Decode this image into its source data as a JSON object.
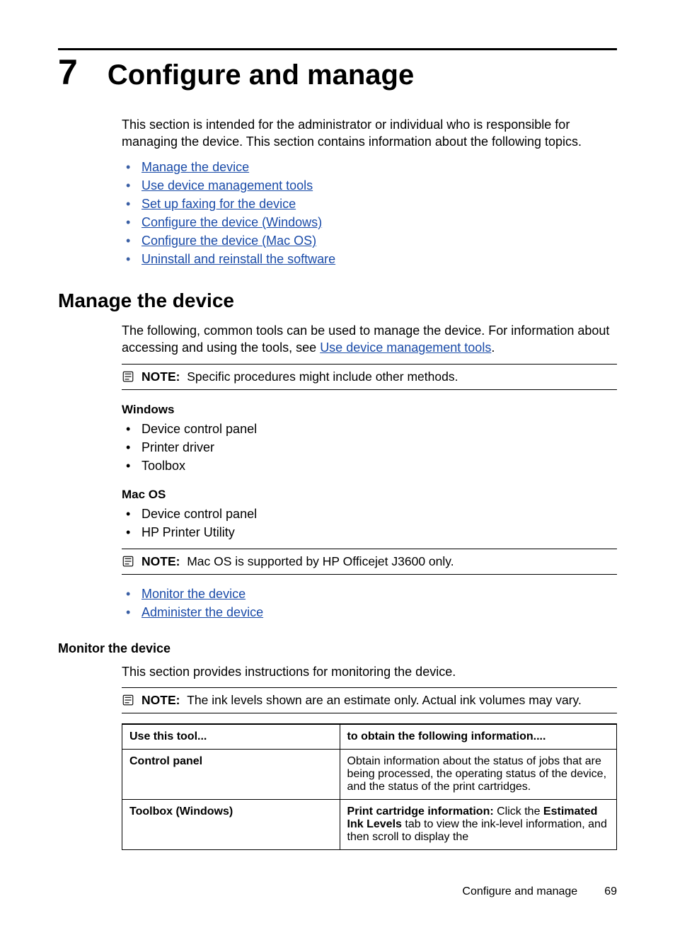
{
  "chapter": {
    "number": "7",
    "title": "Configure and manage"
  },
  "intro": "This section is intended for the administrator or individual who is responsible for managing the device. This section contains information about the following topics.",
  "toc": [
    "Manage the device",
    "Use device management tools",
    "Set up faxing for the device",
    "Configure the device (Windows)",
    "Configure the device (Mac OS)",
    "Uninstall and reinstall the software"
  ],
  "manage": {
    "heading": "Manage the device",
    "para_pre": "The following, common tools can be used to manage the device. For information about accessing and using the tools, see ",
    "para_link": "Use device management tools",
    "para_post": ".",
    "note1": {
      "label": "NOTE:",
      "text": "Specific procedures might include other methods."
    },
    "windows": {
      "heading": "Windows",
      "items": [
        "Device control panel",
        "Printer driver",
        "Toolbox"
      ]
    },
    "macos": {
      "heading": "Mac OS",
      "items": [
        "Device control panel",
        "HP Printer Utility"
      ]
    },
    "note2": {
      "label": "NOTE:",
      "text": "Mac OS is supported by HP Officejet J3600 only."
    },
    "sublinks": [
      "Monitor the device",
      "Administer the device"
    ]
  },
  "monitor": {
    "heading": "Monitor the device",
    "para": "This section provides instructions for monitoring the device.",
    "note": {
      "label": "NOTE:",
      "text": "The ink levels shown are an estimate only. Actual ink volumes may vary."
    },
    "table": {
      "col1": "Use this tool...",
      "col2": "to obtain the following information....",
      "rows": [
        {
          "tool": "Control panel",
          "info_plain": "Obtain information about the status of jobs that are being processed, the operating status of the device, and the status of the print cartridges."
        },
        {
          "tool": "Toolbox (Windows)",
          "info_bold1": "Print cartridge information:",
          "info_mid1": " Click the ",
          "info_bold2": "Estimated Ink Levels",
          "info_mid2": " tab to view the ink-level information, and then scroll to display the"
        }
      ]
    }
  },
  "footer": {
    "text": "Configure and manage",
    "page": "69"
  }
}
